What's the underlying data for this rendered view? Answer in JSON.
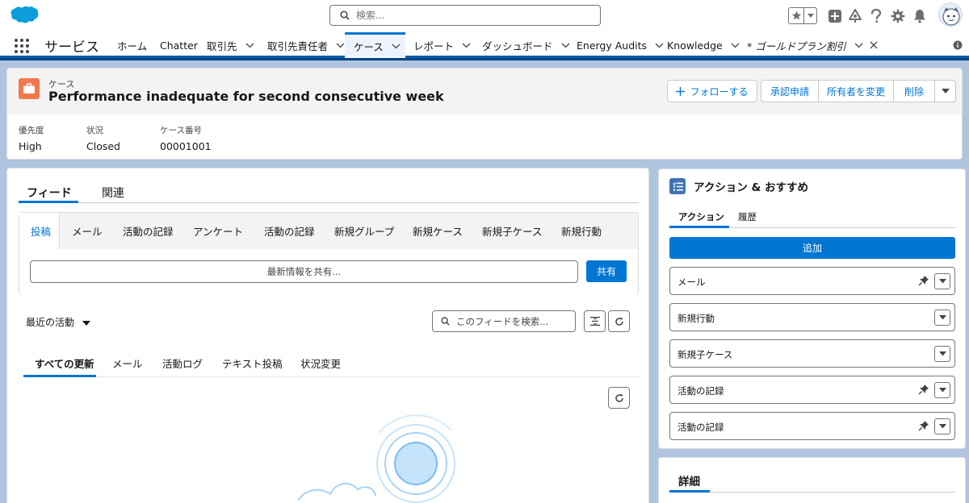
{
  "header": {
    "search_placeholder": "検索..."
  },
  "nav": {
    "app_name": "サービス",
    "items": [
      {
        "label": "ホーム"
      },
      {
        "label": "Chatter"
      },
      {
        "label": "取引先"
      },
      {
        "label": "取引先責任者"
      },
      {
        "label": "ケース"
      },
      {
        "label": "レポート"
      },
      {
        "label": "ダッシュボード"
      },
      {
        "label": "Energy Audits"
      },
      {
        "label": "Knowledge"
      },
      {
        "label": "* ゴールドプラン割引"
      }
    ]
  },
  "record": {
    "object_label": "ケース",
    "title": "Performance inadequate for second consecutive week",
    "buttons": {
      "follow": "フォローする",
      "approval": "承認申請",
      "change_owner": "所有者を変更",
      "delete": "削除"
    },
    "fields": [
      {
        "label": "優先度",
        "value": "High"
      },
      {
        "label": "状況",
        "value": "Closed"
      },
      {
        "label": "ケース番号",
        "value": "00001001"
      }
    ]
  },
  "main": {
    "tabs": [
      {
        "label": "フィード"
      },
      {
        "label": "関連"
      }
    ],
    "publisher": {
      "tabs": [
        {
          "label": "投稿"
        },
        {
          "label": "メール"
        },
        {
          "label": "活動の記録"
        },
        {
          "label": "アンケート"
        },
        {
          "label": "活動の記録"
        },
        {
          "label": "新規グループ"
        },
        {
          "label": "新規ケース"
        },
        {
          "label": "新規子ケース"
        },
        {
          "label": "新規行動"
        }
      ],
      "share_placeholder": "最新情報を共有...",
      "share_button": "共有"
    },
    "sort_label": "最近の活動",
    "feed_search_placeholder": "このフィードを検索...",
    "filter_tabs": [
      {
        "label": "すべての更新"
      },
      {
        "label": "メール"
      },
      {
        "label": "活動ログ"
      },
      {
        "label": "テキスト投稿"
      },
      {
        "label": "状況変更"
      }
    ]
  },
  "actions": {
    "title": "アクション & おすすめ",
    "tabs": [
      {
        "label": "アクション"
      },
      {
        "label": "履歴"
      }
    ],
    "add_button": "追加",
    "items": [
      {
        "label": "メール",
        "pinned": true
      },
      {
        "label": "新規行動",
        "pinned": false
      },
      {
        "label": "新規子ケース",
        "pinned": false
      },
      {
        "label": "活動の記録",
        "pinned": true
      },
      {
        "label": "活動の記録",
        "pinned": true
      }
    ]
  },
  "details": {
    "title": "詳細"
  },
  "colors": {
    "brand": "#0176d3",
    "case_icon": "#f2784b",
    "actions_icon": "#3e74b4",
    "background": "#b0c4df"
  }
}
